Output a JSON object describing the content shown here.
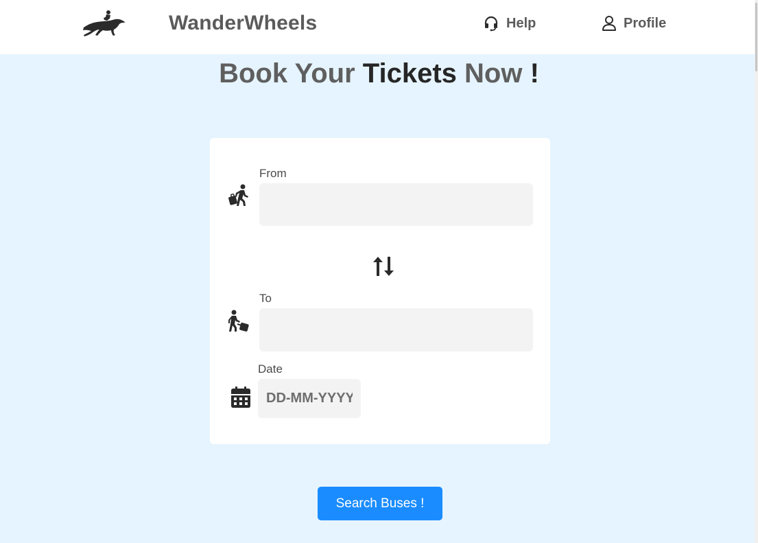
{
  "header": {
    "brand": "WanderWheels",
    "logo_icon": "horse-rider-icon",
    "nav": {
      "help_label": "Help",
      "help_icon": "headset-icon",
      "profile_label": "Profile",
      "profile_icon": "user-icon"
    }
  },
  "main": {
    "title_part1": "Book Your ",
    "title_part2": "Tickets",
    "title_part3": " Now ",
    "title_part4": "!"
  },
  "form": {
    "from": {
      "label": "From",
      "value": "",
      "placeholder": "",
      "icon": "person-walking-luggage-icon"
    },
    "swap_icon": "swap-arrows-icon",
    "to": {
      "label": "To",
      "value": "",
      "placeholder": "",
      "icon": "person-walking-arrow-luggage-icon"
    },
    "date": {
      "label": "Date",
      "value": "",
      "placeholder": "DD-MM-YYYY",
      "icon": "calendar-icon"
    }
  },
  "actions": {
    "search_label": "Search Buses !"
  },
  "colors": {
    "background": "#e6f4ff",
    "header": "#ffffff",
    "accent": "#1a8cff",
    "text": "#5b5b5b",
    "input_bg": "#f3f3f3"
  }
}
